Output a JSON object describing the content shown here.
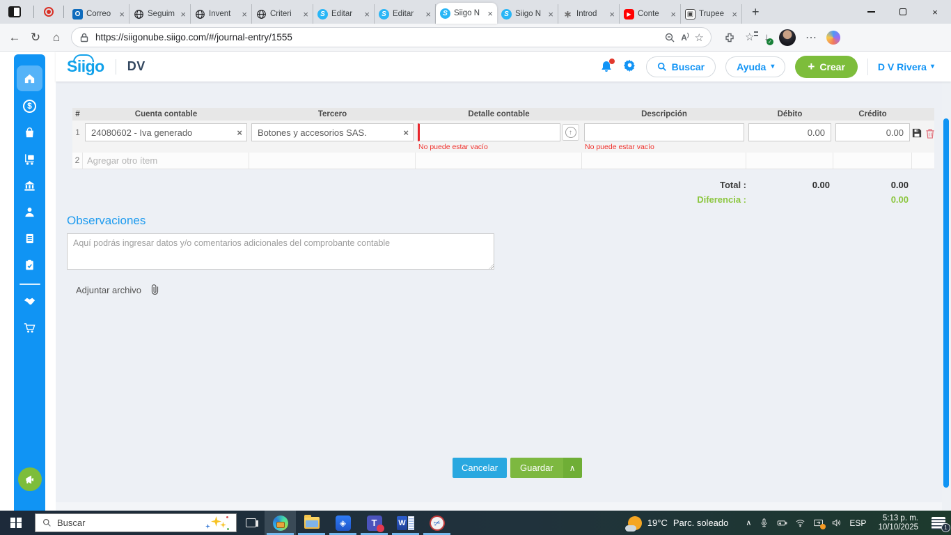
{
  "browser": {
    "tabs": [
      {
        "label": "Correo",
        "icon": "outlook-icon"
      },
      {
        "label": "Seguim",
        "icon": "globe-icon"
      },
      {
        "label": "Invent",
        "icon": "globe-icon"
      },
      {
        "label": "Criteri",
        "icon": "globe-icon"
      },
      {
        "label": "Editar",
        "icon": "siigo-icon"
      },
      {
        "label": "Editar",
        "icon": "siigo-icon"
      },
      {
        "label": "Siigo N",
        "icon": "siigo-icon"
      },
      {
        "label": "Siigo N",
        "icon": "siigo-icon"
      },
      {
        "label": "Introd",
        "icon": "chatgpt-icon"
      },
      {
        "label": "Conte",
        "icon": "youtube-icon"
      },
      {
        "label": "Trupee",
        "icon": "trupee-icon"
      }
    ],
    "url": "https://siigonube.siigo.com/#/journal-entry/1555"
  },
  "icons": {
    "close": "×",
    "caret_down": "▾",
    "plus": "+",
    "up_arrow": "↑",
    "dots": "⋯",
    "back": "←",
    "refresh": "↻",
    "home": "⌂",
    "star": "☆",
    "play": "▶",
    "check": "✓",
    "chevron_up": "∧",
    "scissors": "✂",
    "diamond": "◈",
    "asterisk": "∗",
    "letter_o": "O",
    "letter_s": "S",
    "letter_t": "T",
    "letter_w": "W",
    "dollar": "$",
    "read_aloud": "A",
    "trupee_glyph": "▣",
    "down_arrow": "↓"
  },
  "app_header": {
    "logo": "Siigo",
    "title": "DV",
    "search": "Buscar",
    "help": "Ayuda",
    "create": "Crear",
    "user": "D V Rivera"
  },
  "journal": {
    "columns": {
      "num": "#",
      "cuenta": "Cuenta contable",
      "tercero": "Tercero",
      "detalle": "Detalle contable",
      "descripcion": "Descripción",
      "debito": "Débito",
      "credito": "Crédito"
    },
    "row1": {
      "num": "1",
      "cuenta": "24080602 - Iva generado",
      "tercero": "Botones y accesorios SAS.",
      "detalle_error": "No puede estar vacío",
      "descripcion_error": "No puede estar vacío",
      "debito": "0.00",
      "credito": "0.00"
    },
    "row2": {
      "num": "2",
      "placeholder": "Agregar otro ítem"
    },
    "totals": {
      "label": "Total :",
      "debito": "0.00",
      "credito": "0.00",
      "diff_label": "Diferencia :",
      "diff": "0.00"
    }
  },
  "observaciones": {
    "title": "Observaciones",
    "placeholder": "Aquí podrás ingresar datos y/o comentarios adicionales del comprobante contable",
    "attach": "Adjuntar archivo"
  },
  "footer": {
    "cancel": "Cancelar",
    "save": "Guardar"
  },
  "taskbar": {
    "search": "Buscar",
    "temp": "19°C",
    "weather": "Parc. soleado",
    "lang": "ESP",
    "time": "5:13 p. m.",
    "date": "10/10/2025",
    "notif": "1"
  }
}
